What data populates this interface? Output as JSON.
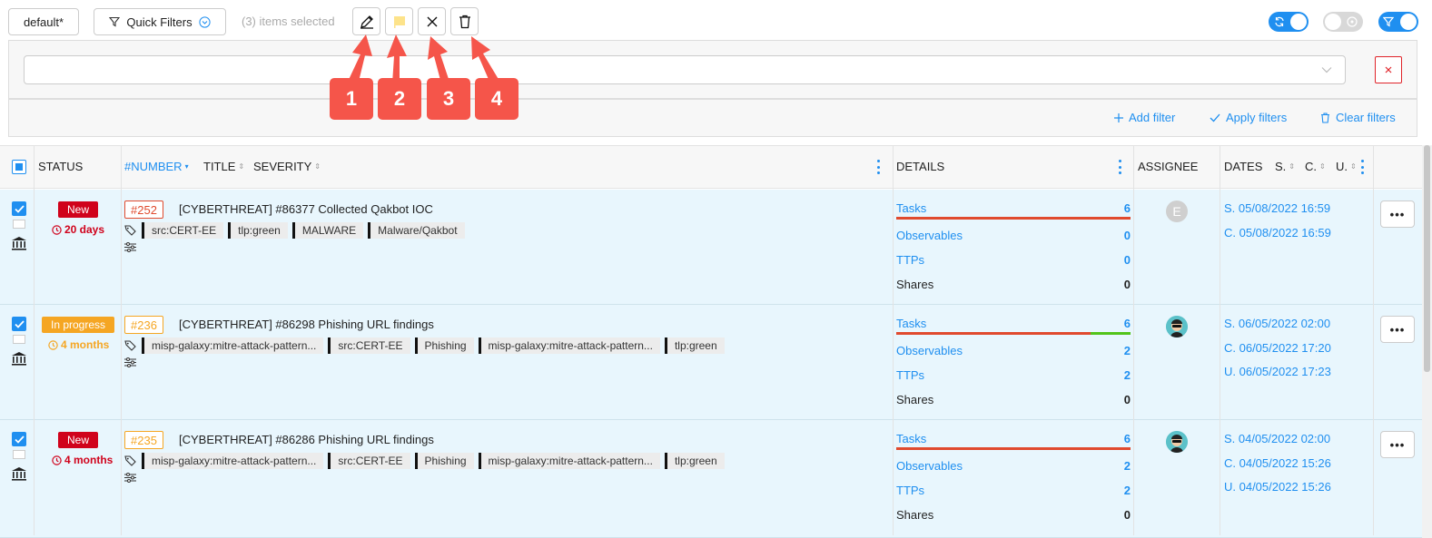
{
  "toolbar": {
    "preset_label": "default*",
    "quick_filters_label": "Quick Filters",
    "selection_status": "(3) items selected"
  },
  "filters": {
    "add_filter": "Add filter",
    "apply_filters": "Apply filters",
    "clear_filters": "Clear filters"
  },
  "callouts": [
    "1",
    "2",
    "3",
    "4"
  ],
  "columns": {
    "status": "STATUS",
    "number": "#NUMBER",
    "title": "TITLE",
    "severity": "SEVERITY",
    "details": "DETAILS",
    "assignee": "ASSIGNEE",
    "dates": "DATES",
    "dates_s": "S.",
    "dates_c": "C.",
    "dates_u": "U."
  },
  "rows": [
    {
      "status": "New",
      "age": "20 days",
      "number": "#252",
      "title": "[CYBERTHREAT] #86377 Collected Qakbot IOC",
      "tags": [
        "src:CERT-EE",
        "tlp:green",
        "MALWARE",
        "Malware/Qakbot"
      ],
      "details": {
        "tasks_label": "Tasks",
        "tasks": "6",
        "obs_label": "Observables",
        "obs": "0",
        "ttps_label": "TTPs",
        "ttps": "0",
        "shares_label": "Shares",
        "shares": "0"
      },
      "tasks_completed_fraction": 0,
      "assignee_initial": "E",
      "dates": [
        "S. 05/08/2022 16:59",
        "C. 05/08/2022 16:59"
      ]
    },
    {
      "status": "In progress",
      "age": "4 months",
      "number": "#236",
      "title": "[CYBERTHREAT] #86298 Phishing URL findings",
      "tags": [
        "misp-galaxy:mitre-attack-pattern...",
        "src:CERT-EE",
        "Phishing",
        "misp-galaxy:mitre-attack-pattern...",
        "tlp:green"
      ],
      "details": {
        "tasks_label": "Tasks",
        "tasks": "6",
        "obs_label": "Observables",
        "obs": "2",
        "ttps_label": "TTPs",
        "ttps": "2",
        "shares_label": "Shares",
        "shares": "0"
      },
      "tasks_completed_fraction": 0.17,
      "assignee_initial": "",
      "dates": [
        "S. 06/05/2022 02:00",
        "C. 06/05/2022 17:20",
        "U. 06/05/2022 17:23"
      ]
    },
    {
      "status": "New",
      "age": "4 months",
      "number": "#235",
      "title": "[CYBERTHREAT] #86286 Phishing URL findings",
      "tags": [
        "misp-galaxy:mitre-attack-pattern...",
        "src:CERT-EE",
        "Phishing",
        "misp-galaxy:mitre-attack-pattern...",
        "tlp:green"
      ],
      "details": {
        "tasks_label": "Tasks",
        "tasks": "6",
        "obs_label": "Observables",
        "obs": "2",
        "ttps_label": "TTPs",
        "ttps": "2",
        "shares_label": "Shares",
        "shares": "0"
      },
      "tasks_completed_fraction": 0,
      "assignee_initial": "",
      "dates": [
        "S. 04/05/2022 02:00",
        "C. 04/05/2022 15:26",
        "U. 04/05/2022 15:26"
      ]
    }
  ],
  "more_label": "•••",
  "colors": {
    "accent": "#1f8ff0",
    "new": "#d0021b",
    "in_progress": "#f5a623",
    "callout": "#f5554a",
    "task_bar": "#e04a2e",
    "task_done": "#52c41a"
  },
  "icons": [
    "funnel-icon",
    "pencil-icon",
    "flag-icon",
    "close-icon",
    "trash-icon",
    "refresh-icon",
    "palette-icon",
    "filter-icon",
    "plus-icon",
    "check-icon",
    "clock-icon",
    "tag-icon",
    "sliders-icon",
    "bank-icon"
  ]
}
